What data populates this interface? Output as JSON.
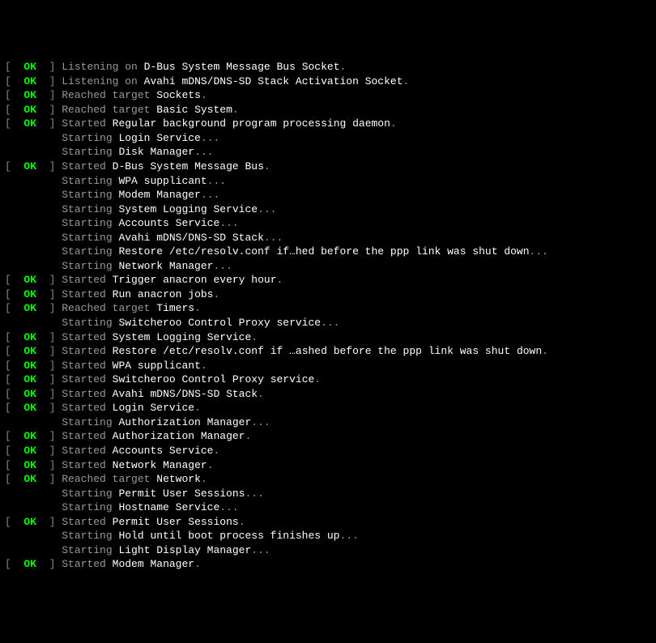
{
  "status": {
    "open": "[  ",
    "ok": "OK",
    "close": "  ] "
  },
  "lines": [
    {
      "type": "ok",
      "action": "Listening on ",
      "subject": "D-Bus System Message Bus Socket",
      "tail": "."
    },
    {
      "type": "ok",
      "action": "Listening on ",
      "subject": "Avahi mDNS/DNS-SD Stack Activation Socket",
      "tail": "."
    },
    {
      "type": "ok",
      "action": "Reached target ",
      "subject": "Sockets",
      "tail": "."
    },
    {
      "type": "ok",
      "action": "Reached target ",
      "subject": "Basic System",
      "tail": "."
    },
    {
      "type": "ok",
      "action": "Started ",
      "subject": "Regular background program processing daemon",
      "tail": "."
    },
    {
      "type": "starting",
      "action": "Starting ",
      "subject": "Login Service",
      "tail": "..."
    },
    {
      "type": "starting",
      "action": "Starting ",
      "subject": "Disk Manager",
      "tail": "..."
    },
    {
      "type": "ok",
      "action": "Started ",
      "subject": "D-Bus System Message Bus",
      "tail": "."
    },
    {
      "type": "starting",
      "action": "Starting ",
      "subject": "WPA supplicant",
      "tail": "..."
    },
    {
      "type": "starting",
      "action": "Starting ",
      "subject": "Modem Manager",
      "tail": "..."
    },
    {
      "type": "starting",
      "action": "Starting ",
      "subject": "System Logging Service",
      "tail": "..."
    },
    {
      "type": "starting",
      "action": "Starting ",
      "subject": "Accounts Service",
      "tail": "..."
    },
    {
      "type": "starting",
      "action": "Starting ",
      "subject": "Avahi mDNS/DNS-SD Stack",
      "tail": "..."
    },
    {
      "type": "starting",
      "action": "Starting ",
      "subject": "Restore /etc/resolv.conf if…hed before the ppp link was shut down",
      "tail": "..."
    },
    {
      "type": "starting",
      "action": "Starting ",
      "subject": "Network Manager",
      "tail": "..."
    },
    {
      "type": "ok",
      "action": "Started ",
      "subject": "Trigger anacron every hour",
      "tail": "."
    },
    {
      "type": "ok",
      "action": "Started ",
      "subject": "Run anacron jobs",
      "tail": "."
    },
    {
      "type": "ok",
      "action": "Reached target ",
      "subject": "Timers",
      "tail": "."
    },
    {
      "type": "starting",
      "action": "Starting ",
      "subject": "Switcheroo Control Proxy service",
      "tail": "..."
    },
    {
      "type": "ok",
      "action": "Started ",
      "subject": "System Logging Service",
      "tail": "."
    },
    {
      "type": "ok",
      "action": "Started ",
      "subject": "Restore /etc/resolv.conf if …ashed before the ppp link was shut down",
      "tail": "."
    },
    {
      "type": "ok",
      "action": "Started ",
      "subject": "WPA supplicant",
      "tail": "."
    },
    {
      "type": "ok",
      "action": "Started ",
      "subject": "Switcheroo Control Proxy service",
      "tail": "."
    },
    {
      "type": "ok",
      "action": "Started ",
      "subject": "Avahi mDNS/DNS-SD Stack",
      "tail": "."
    },
    {
      "type": "ok",
      "action": "Started ",
      "subject": "Login Service",
      "tail": "."
    },
    {
      "type": "starting",
      "action": "Starting ",
      "subject": "Authorization Manager",
      "tail": "..."
    },
    {
      "type": "ok",
      "action": "Started ",
      "subject": "Authorization Manager",
      "tail": "."
    },
    {
      "type": "ok",
      "action": "Started ",
      "subject": "Accounts Service",
      "tail": "."
    },
    {
      "type": "ok",
      "action": "Started ",
      "subject": "Network Manager",
      "tail": "."
    },
    {
      "type": "ok",
      "action": "Reached target ",
      "subject": "Network",
      "tail": "."
    },
    {
      "type": "starting",
      "action": "Starting ",
      "subject": "Permit User Sessions",
      "tail": "..."
    },
    {
      "type": "starting",
      "action": "Starting ",
      "subject": "Hostname Service",
      "tail": "..."
    },
    {
      "type": "ok",
      "action": "Started ",
      "subject": "Permit User Sessions",
      "tail": "."
    },
    {
      "type": "starting",
      "action": "Starting ",
      "subject": "Hold until boot process finishes up",
      "tail": "..."
    },
    {
      "type": "starting",
      "action": "Starting ",
      "subject": "Light Display Manager",
      "tail": "..."
    },
    {
      "type": "ok",
      "action": "Started ",
      "subject": "Modem Manager",
      "tail": "."
    }
  ],
  "indent": "         "
}
